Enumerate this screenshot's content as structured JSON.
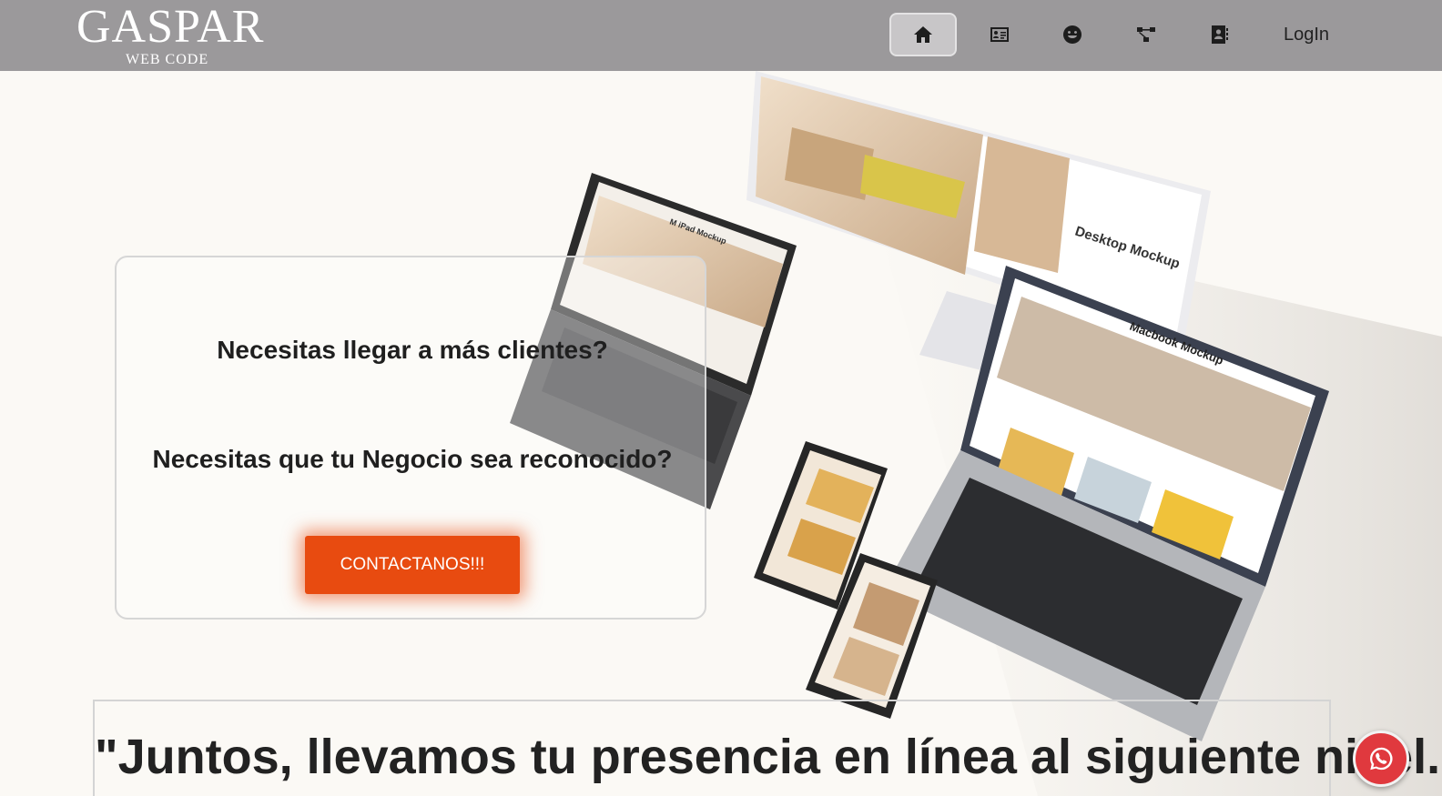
{
  "brand": {
    "name": "GASPAR",
    "tagline": "WEB CODE"
  },
  "nav": {
    "items": [
      {
        "icon": "home-icon",
        "active": true
      },
      {
        "icon": "id-card-icon",
        "active": false
      },
      {
        "icon": "smiley-icon",
        "active": false
      },
      {
        "icon": "network-icon",
        "active": false
      },
      {
        "icon": "contact-book-icon",
        "active": false
      }
    ],
    "login_label": "LogIn"
  },
  "hero": {
    "question_1": "Necesitas llegar a más clientes?",
    "question_2": "Necesitas que tu Negocio sea reconocido?",
    "cta_label": "CONTACTANOS!!!",
    "mockup_labels": {
      "desktop": "Desktop Mockup",
      "tablet": "M iPad Mockup",
      "laptop": "Macbook Mockup"
    }
  },
  "slogan": "\"Juntos, llevamos tu presencia en línea al siguiente nivel.\"",
  "colors": {
    "header_bg": "#9b999b",
    "page_bg": "#fbf9f5",
    "cta_bg": "#e84b10",
    "whatsapp_bg": "#e0393e"
  },
  "floating": {
    "whatsapp_icon": "whatsapp-icon"
  }
}
